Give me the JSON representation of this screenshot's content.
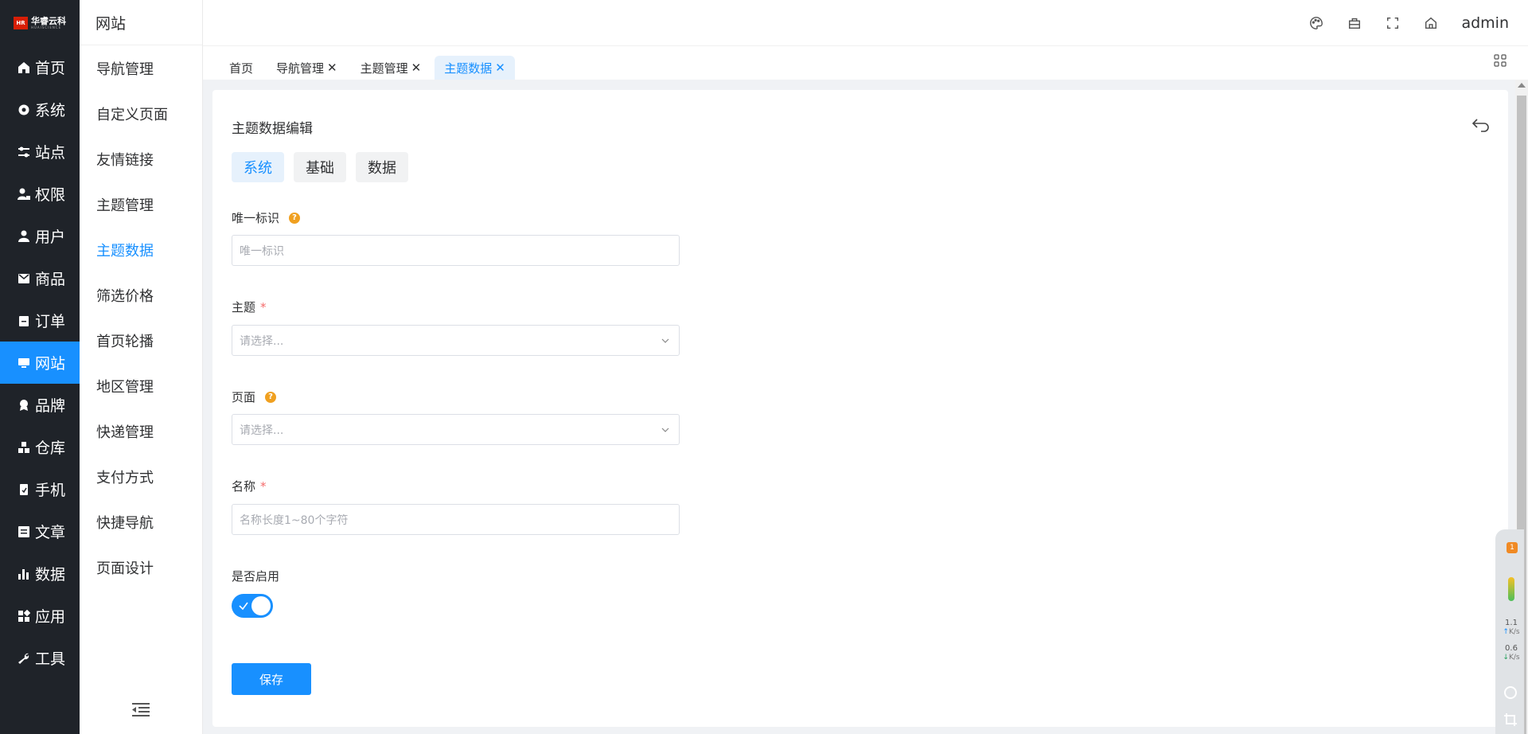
{
  "logo": {
    "text": "华睿云科",
    "sub": "HUAISCIENCE",
    "badge": "HR"
  },
  "main_nav": [
    {
      "label": "首页",
      "icon": "home-icon"
    },
    {
      "label": "系统",
      "icon": "gear-icon"
    },
    {
      "label": "站点",
      "icon": "sliders-icon"
    },
    {
      "label": "权限",
      "icon": "user-lock-icon"
    },
    {
      "label": "用户",
      "icon": "user-icon"
    },
    {
      "label": "商品",
      "icon": "mail-icon"
    },
    {
      "label": "订单",
      "icon": "clipboard-icon"
    },
    {
      "label": "网站",
      "icon": "monitor-icon",
      "active": true
    },
    {
      "label": "品牌",
      "icon": "badge-icon"
    },
    {
      "label": "仓库",
      "icon": "boxes-icon"
    },
    {
      "label": "手机",
      "icon": "phone-icon"
    },
    {
      "label": "文章",
      "icon": "article-icon"
    },
    {
      "label": "数据",
      "icon": "bar-chart-icon"
    },
    {
      "label": "应用",
      "icon": "apps-icon"
    },
    {
      "label": "工具",
      "icon": "wrench-icon"
    }
  ],
  "sub_nav": {
    "title": "网站",
    "items": [
      "导航管理",
      "自定义页面",
      "友情链接",
      "主题管理",
      "主题数据",
      "筛选价格",
      "首页轮播",
      "地区管理",
      "快递管理",
      "支付方式",
      "快捷导航",
      "页面设计"
    ],
    "active": "主题数据"
  },
  "topbar": {
    "user": "admin"
  },
  "tabs": [
    {
      "label": "首页",
      "closable": false
    },
    {
      "label": "导航管理",
      "closable": true
    },
    {
      "label": "主题管理",
      "closable": true
    },
    {
      "label": "主题数据",
      "closable": true,
      "active": true
    }
  ],
  "tab_close_glyph": "✕",
  "card": {
    "title": "主题数据编辑",
    "form_tabs": [
      "系统",
      "基础",
      "数据"
    ],
    "active_form_tab": "系统"
  },
  "form": {
    "unique_id": {
      "label": "唯一标识",
      "placeholder": "唯一标识",
      "help": "?"
    },
    "theme": {
      "label": "主题",
      "required": "*",
      "placeholder": "请选择..."
    },
    "page": {
      "label": "页面",
      "help": "?",
      "placeholder": "请选择..."
    },
    "name": {
      "label": "名称",
      "required": "*",
      "placeholder": "名称长度1~80个字符"
    },
    "enabled": {
      "label": "是否启用",
      "value": true
    },
    "save_label": "保存"
  },
  "widget": {
    "badge": "1",
    "up_speed": "1.1",
    "down_speed": "0.6",
    "unit": "K/s"
  },
  "colors": {
    "accent": "#1890ff",
    "sidebar_bg": "#1f2329",
    "required": "#f56c6c",
    "help": "#f0a020"
  }
}
